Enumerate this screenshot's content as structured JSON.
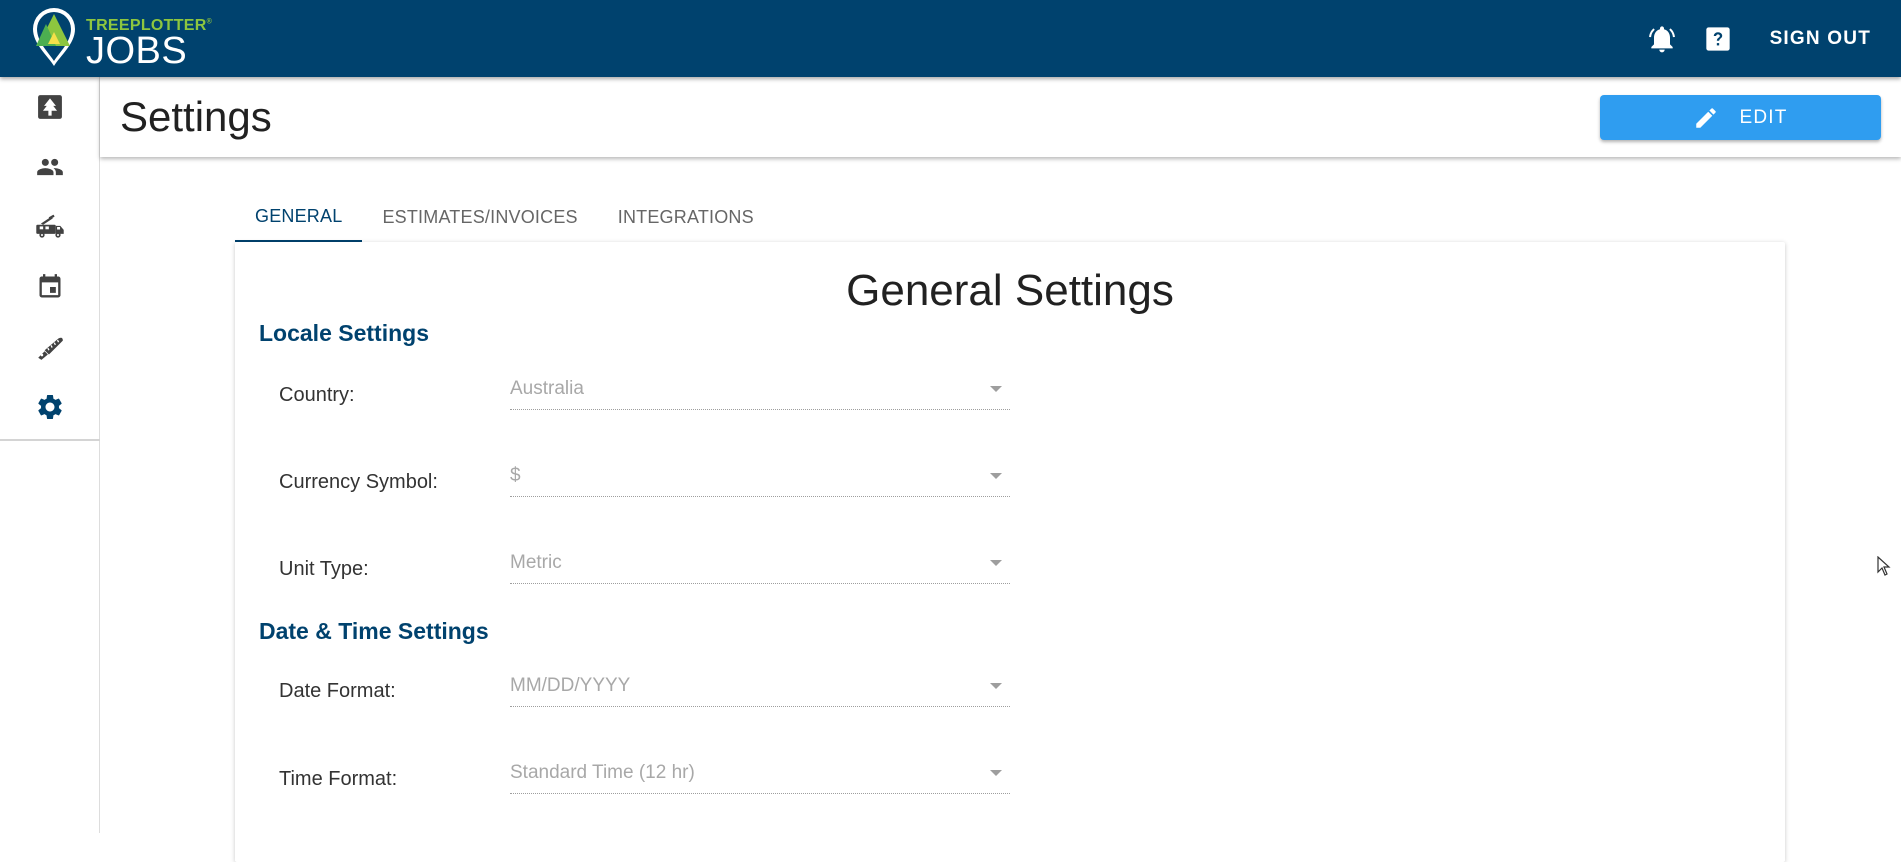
{
  "brand": {
    "top": "TREEPLOTTER",
    "trademark": "®",
    "bottom": "JOBS"
  },
  "appbar": {
    "icons": [
      "notifications-icon",
      "help-icon"
    ],
    "sign_out": "SIGN OUT"
  },
  "nav": {
    "items": [
      "tree-icon",
      "people-icon",
      "truck-icon",
      "calendar-icon",
      "saw-icon",
      "gear-icon"
    ],
    "active": "gear-icon"
  },
  "page": {
    "title": "Settings",
    "edit_label": "EDIT"
  },
  "tabs": [
    {
      "label": "GENERAL",
      "active": true
    },
    {
      "label": "ESTIMATES/INVOICES",
      "active": false
    },
    {
      "label": "INTEGRATIONS",
      "active": false
    }
  ],
  "general": {
    "title": "General Settings",
    "locale": {
      "title": "Locale Settings",
      "country": {
        "label": "Country:",
        "value": "Australia"
      },
      "currency": {
        "label": "Currency Symbol:",
        "value": "$"
      },
      "unit": {
        "label": "Unit Type:",
        "value": "Metric"
      }
    },
    "datetime": {
      "title": "Date & Time Settings",
      "date_format": {
        "label": "Date Format:",
        "value": "MM/DD/YYYY"
      },
      "time_format": {
        "label": "Time Format:",
        "value": "Standard Time (12 hr)"
      }
    }
  },
  "colors": {
    "primary": "#00426e",
    "accent_green": "#8dc63f",
    "button": "#2f9df0"
  }
}
